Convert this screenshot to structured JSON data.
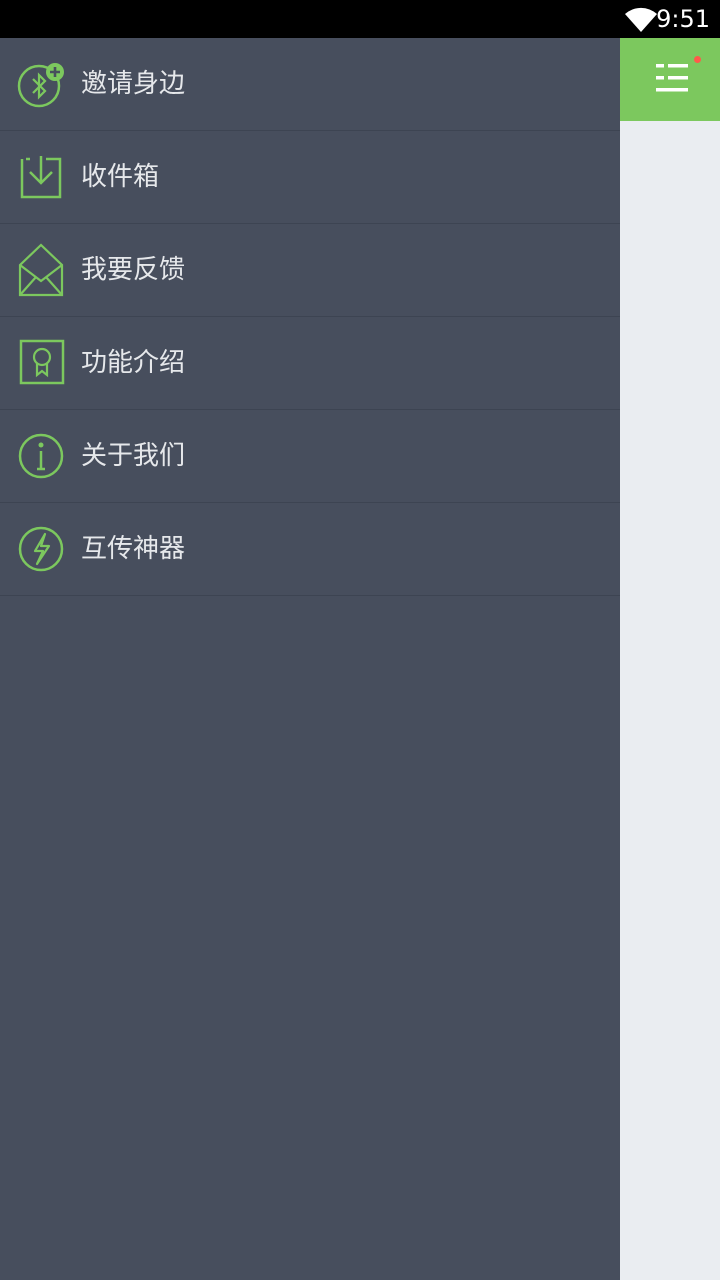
{
  "status_bar": {
    "time": "9:51"
  },
  "drawer": {
    "items": [
      {
        "label": "邀请身边",
        "icon": "bluetooth-add-icon"
      },
      {
        "label": "收件箱",
        "icon": "inbox-icon"
      },
      {
        "label": "我要反馈",
        "icon": "envelope-icon"
      },
      {
        "label": "功能介绍",
        "icon": "badge-icon"
      },
      {
        "label": "关于我们",
        "icon": "info-icon"
      },
      {
        "label": "互传神器",
        "icon": "lightning-icon"
      }
    ]
  },
  "colors": {
    "drawer_bg": "#474e5d",
    "accent_green": "#7cc85e",
    "panel_bg": "#eaedf1",
    "notification_dot": "#ff5a4a"
  }
}
